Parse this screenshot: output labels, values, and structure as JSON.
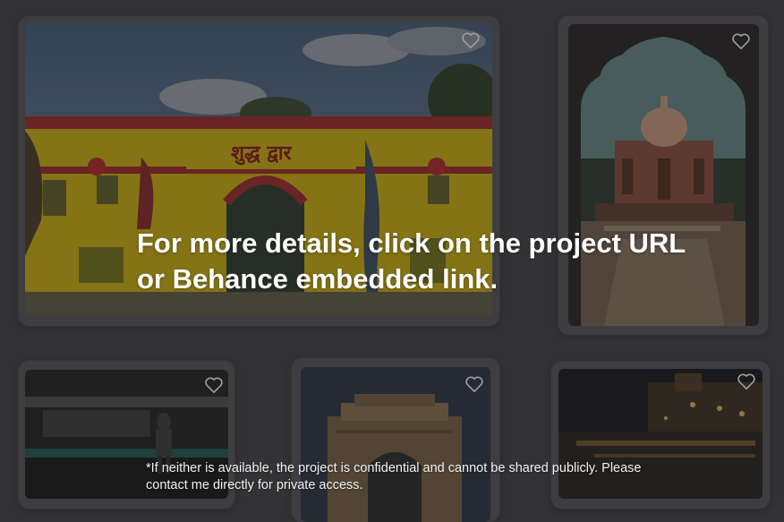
{
  "overlay": {
    "headline": "For more details, click on the project URL or Behance embedded link.",
    "note": "*If neither is available, the project is confidential and cannot be shared publicly. Please contact me directly for private access."
  },
  "gallery": {
    "cards": [
      {
        "image": "street-art-building-photo",
        "favorite_icon": "heart-icon"
      },
      {
        "image": "tomb-through-arch-photo",
        "favorite_icon": "heart-icon"
      },
      {
        "image": "metro-platform-photo",
        "favorite_icon": "heart-icon"
      },
      {
        "image": "india-gate-photo",
        "favorite_icon": "heart-icon"
      },
      {
        "image": "night-street-photo",
        "favorite_icon": "heart-icon"
      }
    ]
  },
  "colors": {
    "overlay_tint": "#18181a",
    "card_background": "#505052",
    "text": "#ffffff"
  }
}
